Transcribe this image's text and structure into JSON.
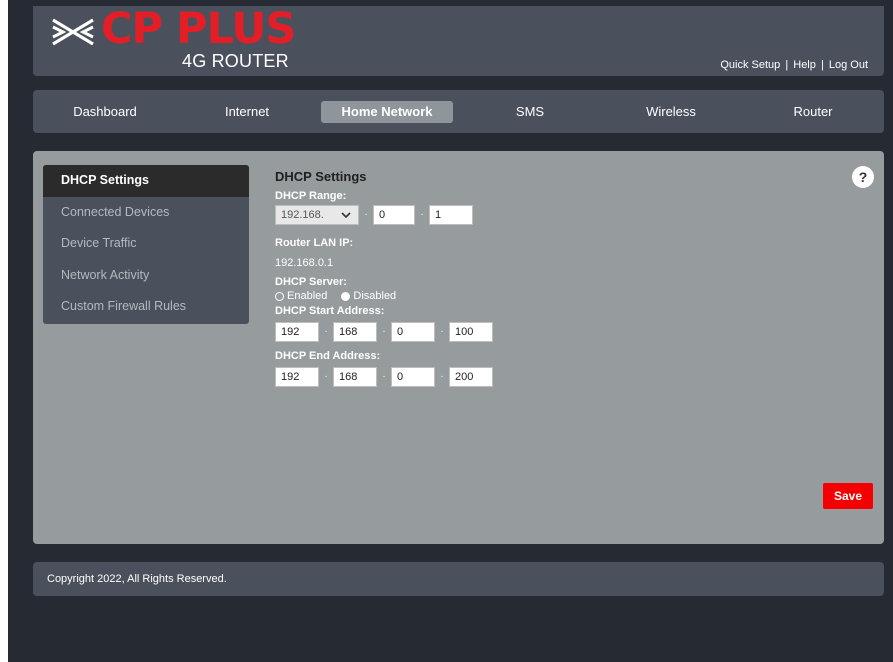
{
  "brand": {
    "logo_text": "CP PLUS",
    "subtitle": "4G ROUTER",
    "accent_color": "#e41e26"
  },
  "top_links": {
    "quick_setup": "Quick Setup",
    "help": "Help",
    "logout": "Log Out",
    "separator": "|"
  },
  "nav": {
    "items": [
      {
        "label": "Dashboard",
        "active": false
      },
      {
        "label": "Internet",
        "active": false
      },
      {
        "label": "Home Network",
        "active": true
      },
      {
        "label": "SMS",
        "active": false
      },
      {
        "label": "Wireless",
        "active": false
      },
      {
        "label": "Router",
        "active": false
      }
    ]
  },
  "sidebar": {
    "items": [
      {
        "label": "DHCP Settings",
        "active": true
      },
      {
        "label": "Connected Devices",
        "active": false
      },
      {
        "label": "Device Traffic",
        "active": false
      },
      {
        "label": "Network Activity",
        "active": false
      },
      {
        "label": "Custom Firewall Rules",
        "active": false
      }
    ]
  },
  "form": {
    "title": "DHCP Settings",
    "range_label": "DHCP Range:",
    "range_select": "192.168.",
    "range_octet3": "0",
    "range_octet4": "1",
    "lan_ip_label": "Router LAN IP:",
    "lan_ip_value": "192.168.0.1",
    "server_label": "DHCP Server:",
    "server_enabled": "Enabled",
    "server_disabled": "Disabled",
    "server_selected": "Disabled",
    "start_label": "DHCP Start Address:",
    "start": [
      "192",
      "168",
      "0",
      "100"
    ],
    "end_label": "DHCP End Address:",
    "end": [
      "192",
      "168",
      "0",
      "200"
    ],
    "octet_separator": "·"
  },
  "help_button": "?",
  "save_button": "Save",
  "footer": {
    "copyright": "Copyright 2022, All Rights Reserved."
  }
}
